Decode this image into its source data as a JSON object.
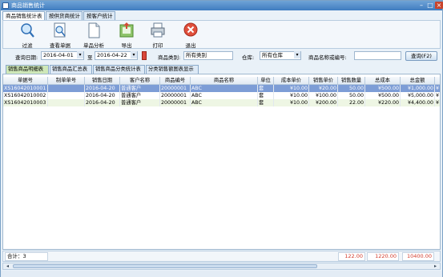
{
  "window": {
    "title": "商品销售统计",
    "min": "–",
    "max": "□",
    "close": "×"
  },
  "main_tabs": [
    {
      "label": "商品销售统计表"
    },
    {
      "label": "按供货商统计"
    },
    {
      "label": "按客户统计"
    }
  ],
  "toolbar": {
    "buttons": [
      {
        "label": "过滤",
        "icon": "magnifier-icon"
      },
      {
        "label": "查看单据",
        "icon": "view-document-icon"
      },
      {
        "label": "单品分析",
        "icon": "document-icon"
      },
      {
        "label": "导出",
        "icon": "export-icon"
      },
      {
        "label": "打印",
        "icon": "printer-icon"
      },
      {
        "label": "退出",
        "icon": "exit-icon"
      }
    ]
  },
  "filters": {
    "date_label": "查询日期:",
    "date_from": "2016-04-01",
    "date_to_sep": "至",
    "date_to": "2016-04-22",
    "category_label": "商品类别:",
    "category_value": "所有类别",
    "warehouse_label": "仓库:",
    "warehouse_value": "所有仓库",
    "name_label": "商品名称或编号:",
    "name_value": "",
    "query_button": "查询(F2)"
  },
  "sub_tabs": [
    {
      "label": "销售商品明细表"
    },
    {
      "label": "销售商品汇总表"
    },
    {
      "label": "销售商品分类统计表"
    },
    {
      "label": "分类销售额图表显示"
    }
  ],
  "table": {
    "columns": [
      "单据号",
      "制单单号",
      "销售日期",
      "客户名称",
      "商品编号",
      "商品名称",
      "单位",
      "成本单价",
      "销售单价",
      "销售数量",
      "总成本",
      "总金额"
    ],
    "rows": [
      [
        "XS16042010001",
        "",
        "2016-04-20",
        "普通客户",
        "20000001",
        "ABC",
        "套",
        "¥10.00",
        "¥20.00",
        "50.00",
        "¥500.00",
        "¥1,000.00"
      ],
      [
        "XS16042010002",
        "",
        "2016-04-20",
        "普通客户",
        "20000001",
        "ABC",
        "套",
        "¥10.00",
        "¥100.00",
        "50.00",
        "¥500.00",
        "¥5,000.00"
      ],
      [
        "XS16042010003",
        "",
        "2016-04-20",
        "普通客户",
        "20000001",
        "ABC",
        "套",
        "¥10.00",
        "¥200.00",
        "22.00",
        "¥220.00",
        "¥4,400.00"
      ]
    ],
    "overflow_col": [
      "¥",
      "¥",
      "¥"
    ]
  },
  "footer": {
    "total_label": "合计：3",
    "total_qty": "122.00",
    "total_cost": "1220.00",
    "total_amount": "10400.00"
  },
  "colors": {
    "selected_row": "#7d9dd6",
    "alt_row": "#eef6e4",
    "red": "#d23a2a"
  }
}
